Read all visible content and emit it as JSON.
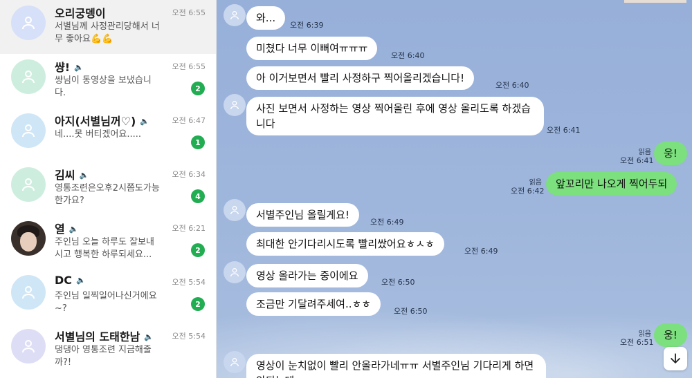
{
  "chat_list": [
    {
      "name": "오리궁뎅이",
      "muted": false,
      "preview": "서별님께 사정관리당해서 너무 좋아요💪💪",
      "time": "오전 6:55",
      "unread": "",
      "avatar_color": "#d6e0f8",
      "photo": false,
      "selected": true
    },
    {
      "name": "썅!",
      "muted": true,
      "preview": "썅님이 동영상을 보냈습니다.",
      "time": "오전 6:55",
      "unread": "2",
      "avatar_color": "#cdeede",
      "photo": false,
      "selected": false
    },
    {
      "name": "아지(서별님꺼♡)",
      "muted": true,
      "preview": "네....못 버티겠어요.....",
      "time": "오전 6:47",
      "unread": "1",
      "avatar_color": "#cfe6f7",
      "photo": false,
      "selected": false
    },
    {
      "name": "김씨",
      "muted": true,
      "preview": "영통조련은오후2시쯤도가능한가요?",
      "time": "오전 6:34",
      "unread": "4",
      "avatar_color": "#cdeede",
      "photo": false,
      "selected": false
    },
    {
      "name": "열",
      "muted": true,
      "preview": "주인님 오늘 하루도 잘보내시고 행복한 하루되세요...",
      "time": "오전 6:21",
      "unread": "2",
      "avatar_color": "#3a302b",
      "photo": true,
      "selected": false
    },
    {
      "name": "DC",
      "muted": true,
      "preview": "주인님 일찍일어나신거에요~?",
      "time": "오전 5:54",
      "unread": "2",
      "avatar_color": "#cfe6f7",
      "photo": false,
      "selected": false
    },
    {
      "name": "서별님의 도태한남",
      "muted": true,
      "preview": "댕댕아 영통조련 지금해줄까?!",
      "time": "오전 5:54",
      "unread": "",
      "avatar_color": "#ddddf6",
      "photo": false,
      "selected": false
    }
  ],
  "icons": {
    "mute": "🔈",
    "scroll_down": "arrow-down-icon"
  },
  "messages": [
    {
      "text": "와...",
      "time": "오전 6:39",
      "mine": false,
      "read": ""
    },
    {
      "text": "미쳤다 너무 이뻐여ㅠㅠㅠ",
      "time": "오전 6:40",
      "mine": false,
      "read": ""
    },
    {
      "text": "아 이거보면서 빨리 사정하구 찍어올리겠습니다!",
      "time": "오전 6:40",
      "mine": false,
      "read": ""
    },
    {
      "text": "사진 보면서 사정하는 영상 찍어올린 후에 영상 올리도록 하겠습니다",
      "time": "오전 6:41",
      "mine": false,
      "read": ""
    },
    {
      "text": "웅!",
      "time": "오전 6:41",
      "mine": true,
      "read": "읽음"
    },
    {
      "text": "앞꼬리만 나오게 찍어두되",
      "time": "오전 6:42",
      "mine": true,
      "read": "읽음"
    },
    {
      "text": "서별주인님 올릴게요!",
      "time": "오전 6:49",
      "mine": false,
      "read": ""
    },
    {
      "text": "최대한 안기다리시도록 빨리쌌어요ㅎㅅㅎ",
      "time": "오전 6:49",
      "mine": false,
      "read": ""
    },
    {
      "text": "영상 올라가는 중이에요",
      "time": "오전 6:50",
      "mine": false,
      "read": ""
    },
    {
      "text": "조금만 기달려주세여..ㅎㅎ",
      "time": "오전 6:50",
      "mine": false,
      "read": ""
    },
    {
      "text": "웅!",
      "time": "오전 6:51",
      "mine": true,
      "read": "읽음"
    },
    {
      "text": "영상이 눈치없이 빨리 안올라가네ㅠㅠ 서별주인님 기다리게 하면 안되는데",
      "time": "",
      "mine": false,
      "read": ""
    }
  ],
  "colors": {
    "unread_badge": "#22ad52",
    "my_bubble": "#7be07d",
    "their_bubble": "#ffffff",
    "chat_background": "#9fb6dc"
  }
}
